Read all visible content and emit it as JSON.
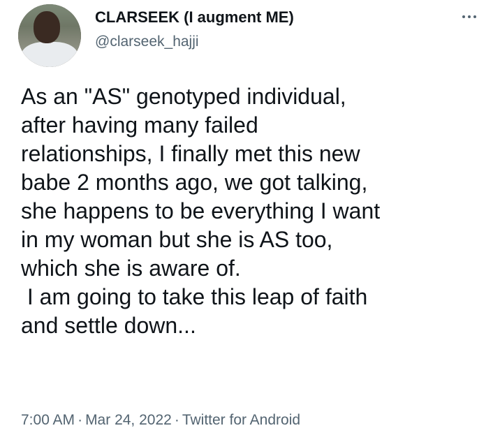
{
  "author": {
    "display_name": "CLARSEEK (I augment ME)",
    "handle": "@clarseek_hajji"
  },
  "tweet": {
    "text": "As an \"AS\" genotyped individual,\nafter having many failed\nrelationships, I finally met this new\nbabe 2 months ago, we got talking,\nshe happens to be everything I want\nin my woman but she is AS too,\nwhich she is aware of.\n I am going to take this leap of faith\nand settle down...",
    "time": "7:00 AM",
    "date": "Mar 24, 2022",
    "source": "Twitter for Android",
    "separator": "·"
  },
  "icons": {
    "more": "more-horizontal-icon",
    "avatar": "avatar"
  },
  "colors": {
    "text": "#0f1419",
    "secondary": "#536471",
    "background": "#ffffff"
  }
}
